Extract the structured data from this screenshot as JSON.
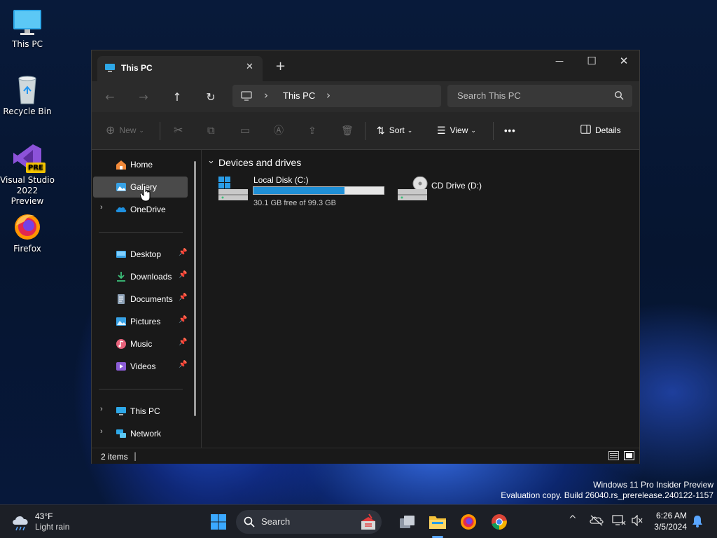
{
  "desktop": {
    "icons": [
      {
        "label": "This PC"
      },
      {
        "label": "Recycle Bin"
      },
      {
        "label": "Visual Studio 2022 Preview",
        "badge": "PRE"
      },
      {
        "label": "Firefox"
      }
    ],
    "watermark": {
      "line1": "Windows 11 Pro Insider Preview",
      "line2": "Evaluation copy. Build 26040.rs_prerelease.240122-1157"
    }
  },
  "window": {
    "tab_title": "This PC",
    "new_tab": "+",
    "controls": {
      "minimize": "—",
      "maximize": "☐",
      "close": "✕"
    },
    "nav": {
      "back": "←",
      "forward": "→",
      "up": "↑",
      "refresh": "↻"
    },
    "breadcrumb": {
      "item": "This PC",
      "sep": "›"
    },
    "search_placeholder": "Search This PC",
    "toolbar": {
      "new_label": "New",
      "sort_label": "Sort",
      "view_label": "View",
      "more_label": "•••",
      "details_label": "Details"
    },
    "sidebar": {
      "top": [
        {
          "label": "Home",
          "icon": "home-icon"
        },
        {
          "label": "Gallery",
          "icon": "gallery-icon",
          "selected": true
        },
        {
          "label": "OneDrive",
          "icon": "onedrive-icon",
          "expandable": true
        }
      ],
      "pinned": [
        {
          "label": "Desktop",
          "icon": "desktop-folder-icon"
        },
        {
          "label": "Downloads",
          "icon": "downloads-folder-icon"
        },
        {
          "label": "Documents",
          "icon": "documents-folder-icon"
        },
        {
          "label": "Pictures",
          "icon": "pictures-folder-icon"
        },
        {
          "label": "Music",
          "icon": "music-folder-icon"
        },
        {
          "label": "Videos",
          "icon": "videos-folder-icon"
        }
      ],
      "bottom": [
        {
          "label": "This PC",
          "icon": "this-pc-icon"
        },
        {
          "label": "Network",
          "icon": "network-icon"
        }
      ]
    },
    "main": {
      "section_title": "Devices and drives",
      "drives": [
        {
          "name": "Local Disk (C:)",
          "free_text": "30.1 GB free of 99.3 GB",
          "used_fraction": 0.697
        },
        {
          "name": "CD Drive (D:)"
        }
      ]
    },
    "status": {
      "items_text": "2 items",
      "cursor": "|"
    }
  },
  "taskbar": {
    "weather": {
      "temp": "43°F",
      "condition": "Light rain"
    },
    "search_label": "Search",
    "clock": {
      "time": "6:26 AM",
      "date": "3/5/2024"
    },
    "tray_chevron": "^"
  },
  "colors": {
    "accent": "#1f8fd6",
    "selected_bg": "#4a4a4a",
    "folder_yellow": "#f3c13a"
  }
}
